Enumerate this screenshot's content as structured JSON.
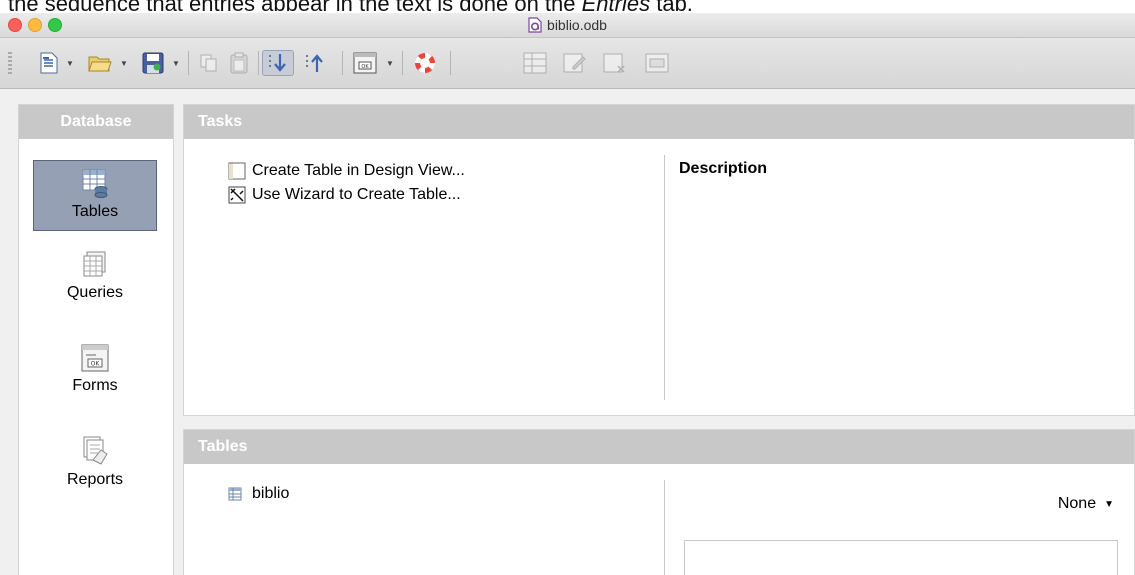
{
  "document": {
    "cropped_line_before": "the sequence that entries appear in the text is done on the ",
    "cropped_line_emph": "Entries",
    "cropped_line_after": " tab."
  },
  "window": {
    "title": "biblio.odb"
  },
  "toolbar": {
    "buttons": [
      "new-document-icon",
      "open-icon",
      "save-icon",
      "copy-icon",
      "paste-icon",
      "sort-ascending-icon",
      "sort-descending-icon",
      "form-icon",
      "help-icon",
      "table-icon",
      "edit-icon",
      "delete-icon",
      "rename-icon"
    ]
  },
  "sidebar": {
    "title": "Database",
    "items": [
      {
        "label": "Tables",
        "selected": true
      },
      {
        "label": "Queries",
        "selected": false
      },
      {
        "label": "Forms",
        "selected": false
      },
      {
        "label": "Reports",
        "selected": false
      }
    ]
  },
  "tasks": {
    "title": "Tasks",
    "items": [
      {
        "label": "Create Table in Design View..."
      },
      {
        "label": "Use Wizard to Create Table..."
      }
    ],
    "description_title": "Description"
  },
  "tables": {
    "title": "Tables",
    "items": [
      {
        "label": "biblio"
      }
    ],
    "preview_option": "None"
  },
  "colors": {
    "selected_bg": "#96a0b4",
    "panel_header": "#c8c8c8"
  }
}
